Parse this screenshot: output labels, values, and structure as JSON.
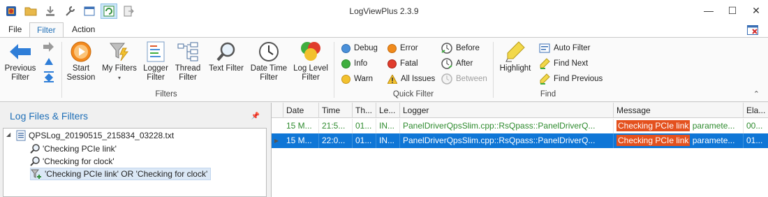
{
  "window": {
    "title": "LogViewPlus 2.3.9",
    "minimize": "—",
    "maximize": "☐",
    "close": "✕"
  },
  "tabs": [
    {
      "label": "File"
    },
    {
      "label": "Filter"
    },
    {
      "label": "Action"
    }
  ],
  "ribbon": {
    "previous_filter": "Previous\nFilter",
    "start_session": "Start\nSession",
    "my_filters": "My Filters",
    "logger_filter": "Logger\nFilter",
    "thread_filter": "Thread\nFilter",
    "text_filter": "Text Filter",
    "date_time_filter": "Date Time\nFilter",
    "log_level_filter": "Log Level\nFilter",
    "filters_group": "Filters",
    "quick": {
      "debug": "Debug",
      "info": "Info",
      "warn": "Warn",
      "error": "Error",
      "fatal": "Fatal",
      "all_issues": "All Issues",
      "before": "Before",
      "after": "After",
      "between": "Between"
    },
    "quick_group": "Quick Filter",
    "highlight": "Highlight",
    "auto_filter": "Auto Filter",
    "find_next": "Find Next",
    "find_previous": "Find Previous",
    "find_group": "Find",
    "colors": {
      "debug": "#4a90d9",
      "info": "#3fae3f",
      "warn": "#f2c12e",
      "error": "#f08a1c",
      "fatal": "#e03c2c"
    }
  },
  "left_panel": {
    "title": "Log Files & Filters",
    "tree": [
      {
        "label": "QPSLog_20190515_215834_03228.txt"
      },
      {
        "label": "'Checking PCIe link'"
      },
      {
        "label": "'Checking for clock'"
      },
      {
        "label": "'Checking PCIe link' OR 'Checking for clock'"
      }
    ]
  },
  "grid": {
    "columns": [
      "Date",
      "Time",
      "Th...",
      "Le...",
      "Logger",
      "Message",
      "Ela..."
    ],
    "rows": [
      {
        "date": "15 M...",
        "time": "21:5...",
        "thread": "01...",
        "level": "IN...",
        "logger": "PanelDriverQpsSlim.cpp::RsQpass::PanelDriverQ...",
        "msg_hl": "Checking PCIe link",
        "msg_rest": " paramete...",
        "elapsed": "00..."
      },
      {
        "date": "15 M...",
        "time": "22:0...",
        "thread": "01...",
        "level": "IN...",
        "logger": "PanelDriverQpsSlim.cpp::RsQpass::PanelDriverQ...",
        "msg_hl": "Checking PCIe link",
        "msg_rest": " paramete...",
        "elapsed": "01..."
      }
    ]
  }
}
